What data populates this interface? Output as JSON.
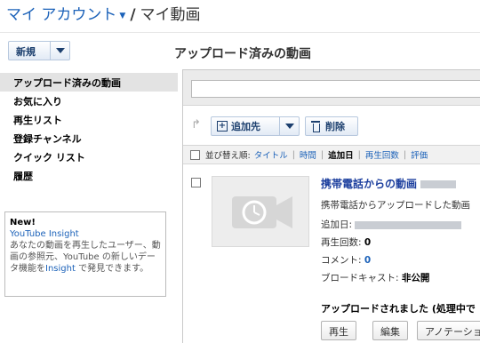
{
  "breadcrumb": {
    "account": "マイ アカウント",
    "separator": "/",
    "current": "マイ動画"
  },
  "new_button": {
    "label": "新規"
  },
  "main": {
    "title": "アップロード済みの動画"
  },
  "sidebar": {
    "items": [
      {
        "label": "アップロード済みの動画"
      },
      {
        "label": "お気に入り"
      },
      {
        "label": "再生リスト"
      },
      {
        "label": "登録チャンネル"
      },
      {
        "label": "クイック リスト"
      },
      {
        "label": "履歴"
      }
    ],
    "info": {
      "new": "New!",
      "link": "YouTube Insight",
      "text_1": "あなたの動画を再生したユーザー、動画の参照元、YouTube の新しいデータ機能を",
      "text_link": "Insight",
      "text_2": " で発見できます。"
    }
  },
  "toolbar": {
    "add_label": "追加先",
    "delete_label": "削除"
  },
  "sort": {
    "label": "並び替え順:",
    "title": "タイトル",
    "time": "時間",
    "added": "追加日",
    "views": "再生回数",
    "rating": "評価"
  },
  "video": {
    "title": "携帯電話からの動画",
    "description": "携帯電話からアップロードした動画",
    "added_label": "追加日:",
    "views_label": "再生回数:",
    "views_value": "0",
    "comments_label": "コメント:",
    "comments_value": "0",
    "broadcast_label": "ブロードキャスト:",
    "broadcast_value": "非公開",
    "uploaded_status": "アップロードされました (処理中で",
    "play_button": "再生",
    "edit_button": "編集",
    "annotation_button": "アノテーショ"
  },
  "colors": {
    "link": "#1c62b9",
    "button_text": "#1c3f6e",
    "selected_bg": "#e3e3e3"
  }
}
